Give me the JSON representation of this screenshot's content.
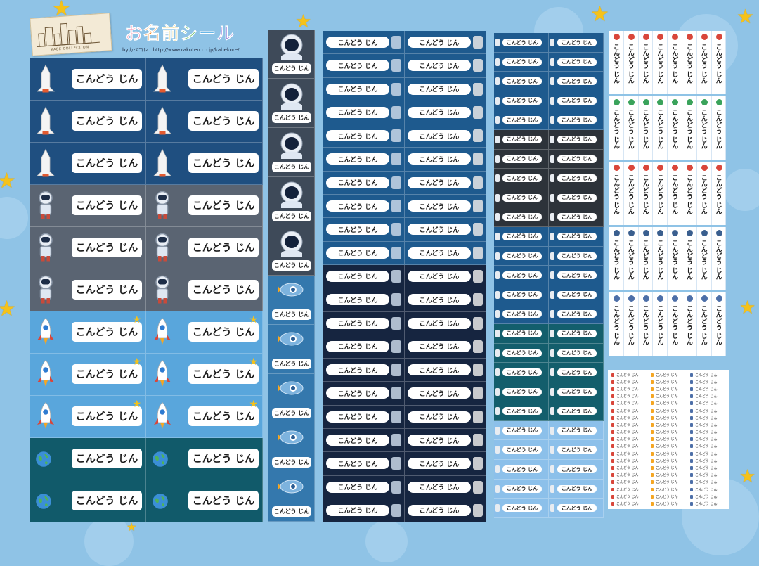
{
  "header": {
    "title_chars": [
      "お",
      "名",
      "前",
      "シ",
      "ー",
      "ル"
    ],
    "logo_sub": "KABE COLLECTION",
    "credit": "byカベコレ　http://www.rakuten.co.jp/kabekore/"
  },
  "sticker_name": "こんどう じん",
  "colors": {
    "background": "#8fc3e6",
    "star": "#f5c21a",
    "navy": "#1f4f80",
    "slate": "#5a6472",
    "sky": "#59a6dc",
    "teal": "#115a6a"
  },
  "big_stickers": [
    {
      "theme": "navy",
      "icon": "space-shuttle-icon"
    },
    {
      "theme": "navy",
      "icon": "space-shuttle-icon"
    },
    {
      "theme": "navy",
      "icon": "space-shuttle-icon"
    },
    {
      "theme": "slate",
      "icon": "astronaut-icon"
    },
    {
      "theme": "slate",
      "icon": "astronaut-icon"
    },
    {
      "theme": "slate",
      "icon": "astronaut-icon"
    },
    {
      "theme": "sky",
      "icon": "rocket-icon"
    },
    {
      "theme": "sky",
      "icon": "rocket-icon"
    },
    {
      "theme": "sky",
      "icon": "rocket-icon"
    },
    {
      "theme": "teal",
      "icon": "earth-icon"
    },
    {
      "theme": "teal",
      "icon": "earth-icon"
    }
  ],
  "helmet_stickers": [
    {
      "icon": "astronaut-helmet-icon"
    },
    {
      "icon": "astronaut-helmet-icon"
    },
    {
      "icon": "astronaut-helmet-icon"
    },
    {
      "icon": "astronaut-helmet-icon"
    },
    {
      "icon": "astronaut-helmet-icon"
    },
    {
      "icon": "spaceship-icon"
    },
    {
      "icon": "spaceship-icon"
    },
    {
      "icon": "spaceship-icon"
    },
    {
      "icon": "spaceship-icon"
    },
    {
      "icon": "spaceship-icon"
    }
  ],
  "medium_sections": [
    {
      "theme": "mid",
      "left_icon": "ufo-icon",
      "right_icon": "satellite-icon",
      "rows": 10
    },
    {
      "theme": "night",
      "left_icon": "rocket-icon",
      "right_icon": "telescope-icon",
      "rows": 11
    }
  ],
  "small_sections": [
    {
      "theme": "mid",
      "rows": 5
    },
    {
      "theme": "dgray",
      "rows": 5
    },
    {
      "theme": "mid",
      "rows": 5
    },
    {
      "theme": "teal2",
      "rows": 5
    },
    {
      "theme": "light",
      "rows": 5
    }
  ],
  "vertical_sections": [
    {
      "icon": "rocket-icon",
      "icon_color": "#d9463a"
    },
    {
      "icon": "earth-icon",
      "icon_color": "#3aa35b"
    },
    {
      "icon": "rocket-icon",
      "icon_color": "#d9463a"
    },
    {
      "icon": "astronaut-icon",
      "icon_color": "#3a5f8f"
    },
    {
      "icon": "ufo-icon",
      "icon_color": "#4d6fa8"
    }
  ],
  "tiny_rows": 19
}
